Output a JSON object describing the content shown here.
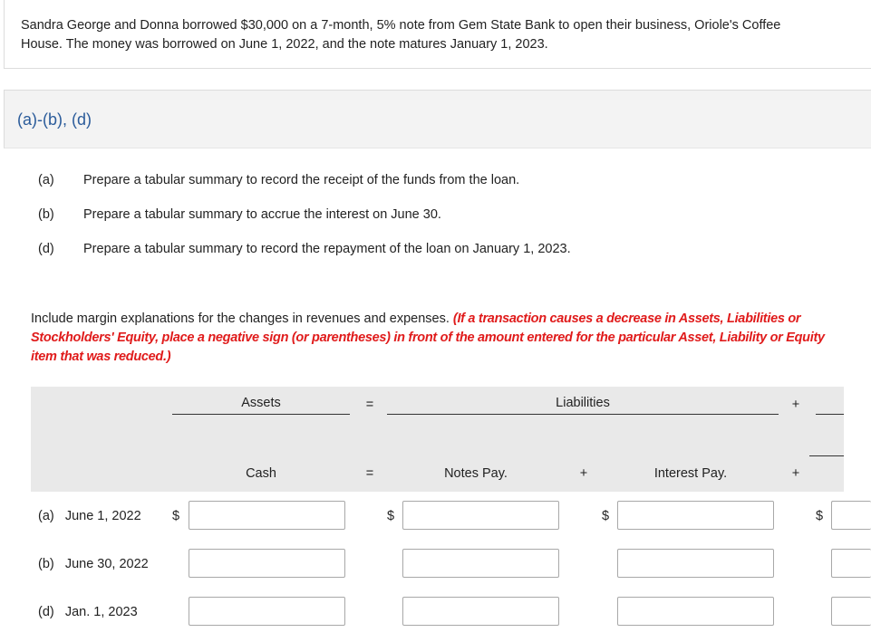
{
  "intro": {
    "line1": "Sandra George and Donna borrowed $30,000 on a 7-month, 5% note from Gem State Bank to open their business, Oriole's Coffee",
    "line2": "House. The money was borrowed on June 1, 2022, and the note matures January 1, 2023."
  },
  "part": {
    "title": "(a)-(b), (d)"
  },
  "tasks": [
    {
      "letter": "(a)",
      "text": "Prepare a tabular summary to record the receipt of the funds from the loan."
    },
    {
      "letter": "(b)",
      "text": "Prepare a tabular summary to accrue the interest on June 30."
    },
    {
      "letter": "(d)",
      "text": "Prepare a tabular summary to record the repayment of the loan on January 1, 2023."
    }
  ],
  "instructions": {
    "plain": "Include margin explanations for the changes in revenues and expenses. ",
    "emphasis": "(If a transaction causes a decrease in Assets, Liabilities or Stockholders' Equity, place a negative sign (or parentheses) in front of the amount entered for the particular Asset, Liability or Equity item that was reduced.)"
  },
  "table": {
    "assets_label": "Assets",
    "liabilities_label": "Liabilities",
    "equals_symbol": "=",
    "plus_symbol": "+",
    "columns": {
      "cash": "Cash",
      "notes_pay": "Notes Pay.",
      "interest_pay": "Interest Pay."
    },
    "currency_symbol": "$",
    "rows": [
      {
        "letter": "(a)",
        "date": "June 1, 2022"
      },
      {
        "letter": "(b)",
        "date": "June 30, 2022"
      },
      {
        "letter": "(d)",
        "date": "Jan. 1, 2023"
      }
    ]
  }
}
